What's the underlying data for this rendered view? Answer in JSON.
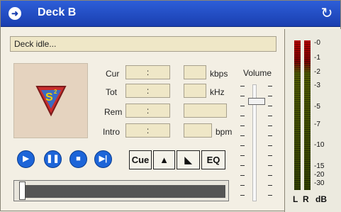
{
  "window": {
    "title": "Deck B"
  },
  "status_text": "Deck idle...",
  "logo": {
    "text": "S",
    "superscript": "2"
  },
  "time_fields": [
    {
      "label": "Cur",
      "value": ":"
    },
    {
      "label": "Tot",
      "value": ":"
    },
    {
      "label": "Rem",
      "value": ":"
    },
    {
      "label": "Intro",
      "value": ":"
    }
  ],
  "info_fields": [
    {
      "unit": "kbps",
      "value": ""
    },
    {
      "unit": "kHz",
      "value": ""
    },
    {
      "unit": "",
      "value": ""
    },
    {
      "unit": "bpm",
      "value": ""
    }
  ],
  "volume_label": "Volume",
  "transport": [
    "play-icon",
    "pause-icon",
    "stop-icon",
    "next-icon"
  ],
  "buttons": {
    "cue": "Cue",
    "eject": "▲",
    "ramp": "◣",
    "eq": "EQ"
  },
  "meter": {
    "scale": [
      "-0",
      "-1",
      "-2",
      "-3",
      "-5",
      "-7",
      "-10",
      "-15",
      "-20",
      "-30"
    ],
    "labels": {
      "left": "L",
      "right": "R",
      "db": "dB"
    }
  },
  "colors": {
    "accent": "#1d65d8",
    "title_bg": "#1a3fb0"
  }
}
